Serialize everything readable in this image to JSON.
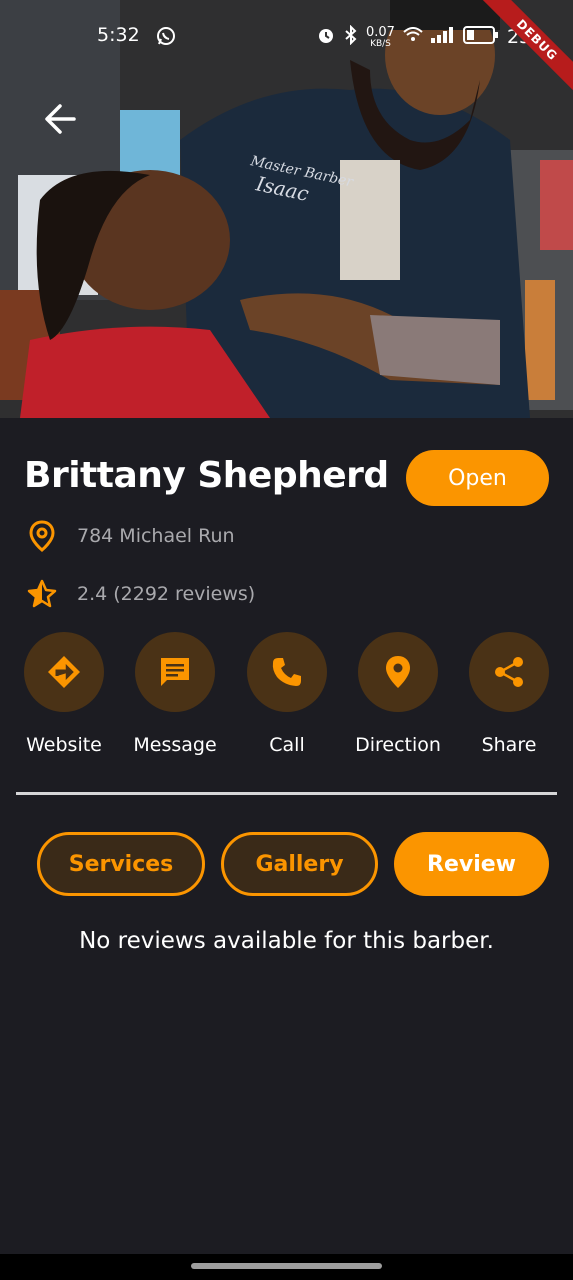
{
  "status_bar": {
    "time": "5:32",
    "net_speed_value": "0.07",
    "net_speed_unit": "KB/S",
    "battery": "23",
    "debug_banner": "DEBUG"
  },
  "hero": {
    "jacket_line1": "Master Barber",
    "jacket_line2": "Isaac"
  },
  "barber": {
    "name": "Brittany Shepherd",
    "status": "Open",
    "address": "784 Michael Run",
    "rating": "2.4 (2292 reviews)"
  },
  "actions": [
    {
      "label": "Website",
      "icon": "directions-icon"
    },
    {
      "label": "Message",
      "icon": "message-icon"
    },
    {
      "label": "Call",
      "icon": "phone-icon"
    },
    {
      "label": "Direction",
      "icon": "location-pin-icon"
    },
    {
      "label": "Share",
      "icon": "share-icon"
    }
  ],
  "tabs": [
    {
      "label": "Services",
      "active": false
    },
    {
      "label": "Gallery",
      "active": false
    },
    {
      "label": "Review",
      "active": true
    }
  ],
  "empty_message": "No reviews available for this barber.",
  "colors": {
    "accent": "#fb9500",
    "background": "#1c1c22",
    "action_circle": "#4a3216",
    "secondary_text": "#a9a9ad"
  }
}
